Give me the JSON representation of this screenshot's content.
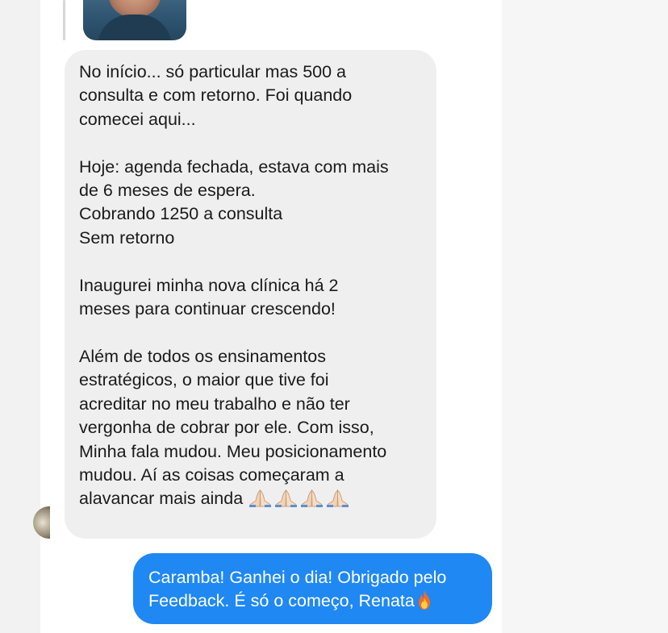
{
  "messages": {
    "received": {
      "lines": [
        "No início... só particular mas 500 a",
        "consulta e com retorno. Foi quando",
        "comecei aqui...",
        "",
        "Hoje: agenda fechada, estava com mais",
        "de 6 meses de espera.",
        "Cobrando 1250 a consulta",
        "Sem retorno",
        "",
        "Inaugurei minha nova clínica há 2",
        "meses para continuar crescendo!",
        "",
        "Além de todos os ensinamentos",
        "estratégicos, o maior que tive foi",
        "acreditar no meu trabalho e não ter",
        "vergonha de cobrar por ele. Com isso,",
        "Minha fala mudou. Meu posicionamento",
        "mudou. Aí as coisas começaram a",
        "alavancar mais ainda"
      ],
      "trailing_emoji": [
        "praying-hands-icon",
        "praying-hands-icon",
        "praying-hands-icon",
        "praying-hands-icon"
      ]
    },
    "sent": {
      "line1": "Caramba! Ganhei o dia! Obrigado pelo",
      "line2": "Feedback. É só o começo, Renata",
      "trailing_emoji": "fire-icon"
    }
  },
  "colors": {
    "received_bubble": "#efefef",
    "sent_bubble": "#1f88f3",
    "text_dark": "#1a1a1a",
    "text_light": "#ffffff"
  }
}
